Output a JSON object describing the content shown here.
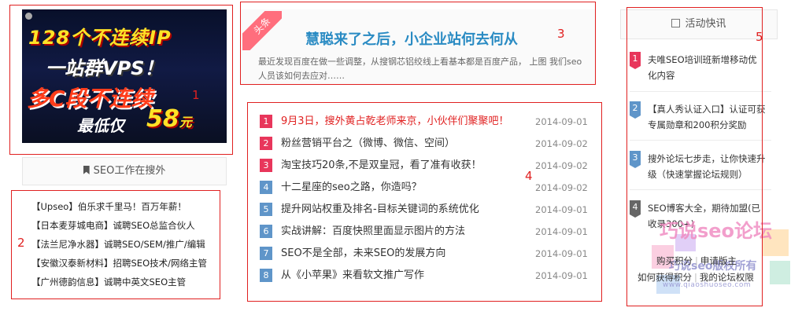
{
  "annotations": [
    "1",
    "2",
    "3",
    "4",
    "5"
  ],
  "banner": {
    "line1": "128个不连续IP",
    "line2": "一站群VPS！",
    "line3": "多C段不连续",
    "line4": "最低仅",
    "price": "58",
    "unit": "元"
  },
  "jobs": {
    "header": "SEO工作在搜外",
    "icon": "bookmark-icon",
    "items": [
      "【Upseo】伯乐求千里马！百万年薪！",
      "【日本麦芽城电商】诚聘SEO总监合伙人",
      "【法兰尼净水器】诚聘SEO/SEM/推广/编辑",
      "【安徽汉泰新材料】招聘SEO技术/网络主管",
      "【广州德韵信息】诚聘中英文SEO主管"
    ]
  },
  "headline": {
    "ribbon": "头条",
    "title": "慧聪来了之后，小企业站何去何从",
    "desc": "最近发现百度在做一些调整，从搜钢芯铝绞线上看基本都是百度产品， 上图 我们seo人员该如何去应对……"
  },
  "news": [
    {
      "num": "1",
      "title": "9月3日，搜外黄占乾老师来京，小伙伴们聚聚吧！",
      "date": "2014-09-01",
      "hot": true
    },
    {
      "num": "2",
      "title": "粉丝营销平台之（微博、微信、空间）",
      "date": "2014-09-02",
      "hot": false
    },
    {
      "num": "3",
      "title": "淘宝技巧20条,不是双皇冠，看了准有收获！",
      "date": "2014-09-02",
      "hot": false
    },
    {
      "num": "4",
      "title": "十二星座的seo之路，你造吗？",
      "date": "2014-09-02",
      "hot": false
    },
    {
      "num": "5",
      "title": "提升网站权重及排名-目标关键词的系统优化",
      "date": "2014-09-01",
      "hot": false
    },
    {
      "num": "6",
      "title": "实战讲解：百度快照里面显示图片的方法",
      "date": "2014-09-01",
      "hot": false
    },
    {
      "num": "7",
      "title": "SEO不是全部，未来SEO的发展方向",
      "date": "2014-09-01",
      "hot": false
    },
    {
      "num": "8",
      "title": "从《小苹果》来看软文推广写作",
      "date": "2014-09-01",
      "hot": false
    }
  ],
  "activity": {
    "header": "活动快讯",
    "icon": "news-icon",
    "items": [
      {
        "num": "1",
        "text": "夫唯SEO培训班新增移动优化内容"
      },
      {
        "num": "2",
        "text": "【真人秀认证入口】认证可获专属勋章和200积分奖励"
      },
      {
        "num": "3",
        "text": "搜外论坛七步走，让你快速升级（快速掌握论坛规则）"
      },
      {
        "num": "4",
        "text": "SEO博客大全，期待加盟(已收录300+)"
      }
    ],
    "links_row1": [
      "购买积分",
      "申请版主"
    ],
    "links_row2": [
      "如何获得积分",
      "我的论坛权限"
    ]
  },
  "watermark": {
    "title": "巧说seo论坛",
    "sub": "巧说seo版权所有",
    "url": "www.qiaoshuoseo.com"
  }
}
